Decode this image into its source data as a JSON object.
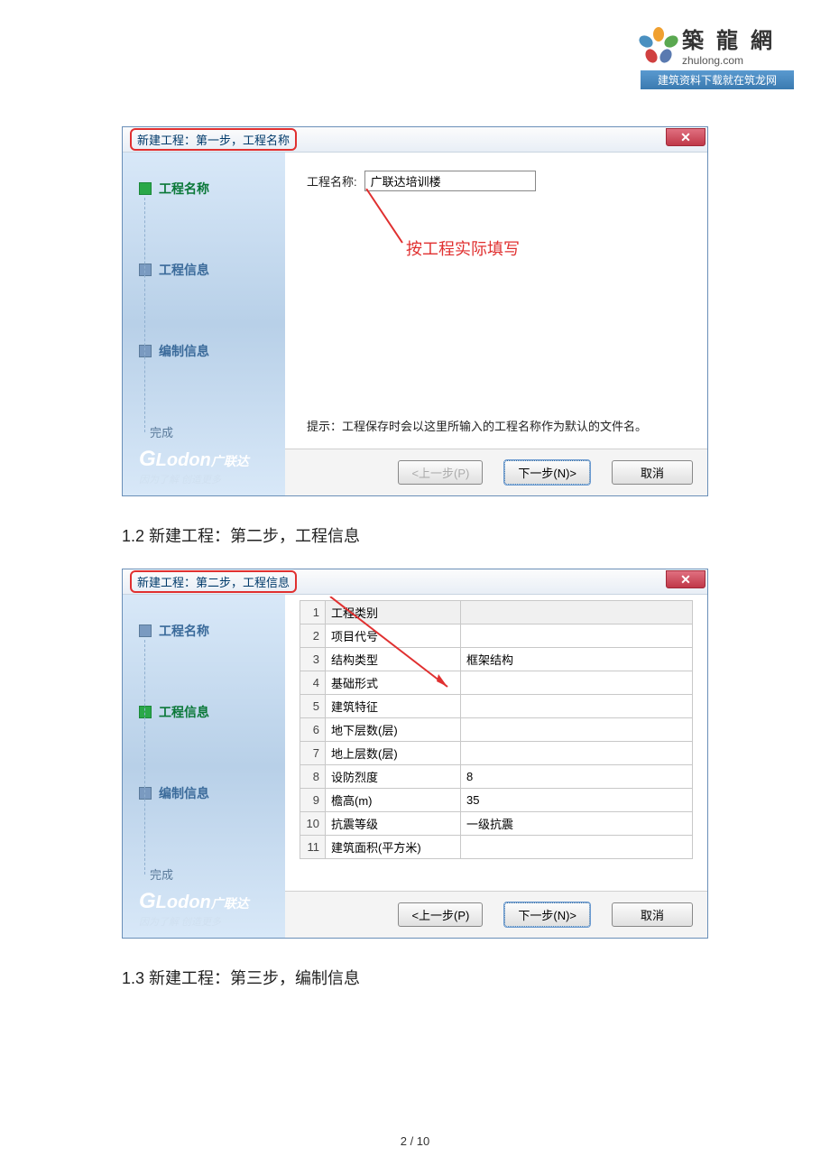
{
  "logo": {
    "cn": "築 龍 網",
    "en": "zhulong.com",
    "banner": "建筑资料下载就在筑龙网"
  },
  "dialog1": {
    "title": "新建工程：第一步，工程名称",
    "close": "✕",
    "steps": {
      "s1": "工程名称",
      "s2": "工程信息",
      "s3": "编制信息",
      "done": "完成"
    },
    "form": {
      "label": "工程名称:",
      "value": "广联达培训楼"
    },
    "annotation": "按工程实际填写",
    "hint": "提示：工程保存时会以这里所输入的工程名称作为默认的文件名。",
    "btn_prev": "<上一步(P)",
    "btn_next": "下一步(N)>",
    "btn_cancel": "取消"
  },
  "brand": {
    "main_prefix": "G",
    "main": "Lodon",
    "suffix": "广联达",
    "sub": "因为了解 创造更多"
  },
  "heading12": "1.2 新建工程：第二步，工程信息",
  "dialog2": {
    "title": "新建工程：第二步，工程信息",
    "close": "✕",
    "rows": [
      {
        "idx": "1",
        "key": "工程类别",
        "val": ""
      },
      {
        "idx": "2",
        "key": "项目代号",
        "val": ""
      },
      {
        "idx": "3",
        "key": "结构类型",
        "val": "框架结构"
      },
      {
        "idx": "4",
        "key": "基础形式",
        "val": ""
      },
      {
        "idx": "5",
        "key": "建筑特征",
        "val": ""
      },
      {
        "idx": "6",
        "key": "地下层数(层)",
        "val": ""
      },
      {
        "idx": "7",
        "key": "地上层数(层)",
        "val": ""
      },
      {
        "idx": "8",
        "key": "设防烈度",
        "val": "8"
      },
      {
        "idx": "9",
        "key": "檐高(m)",
        "val": "35"
      },
      {
        "idx": "10",
        "key": "抗震等级",
        "val": "一级抗震"
      },
      {
        "idx": "11",
        "key": "建筑面积(平方米)",
        "val": ""
      }
    ],
    "btn_prev": "<上一步(P)",
    "btn_next": "下一步(N)>",
    "btn_cancel": "取消"
  },
  "heading13": "1.3 新建工程：第三步，编制信息",
  "page": {
    "current": "2",
    "total": "10",
    "sep": " / "
  }
}
